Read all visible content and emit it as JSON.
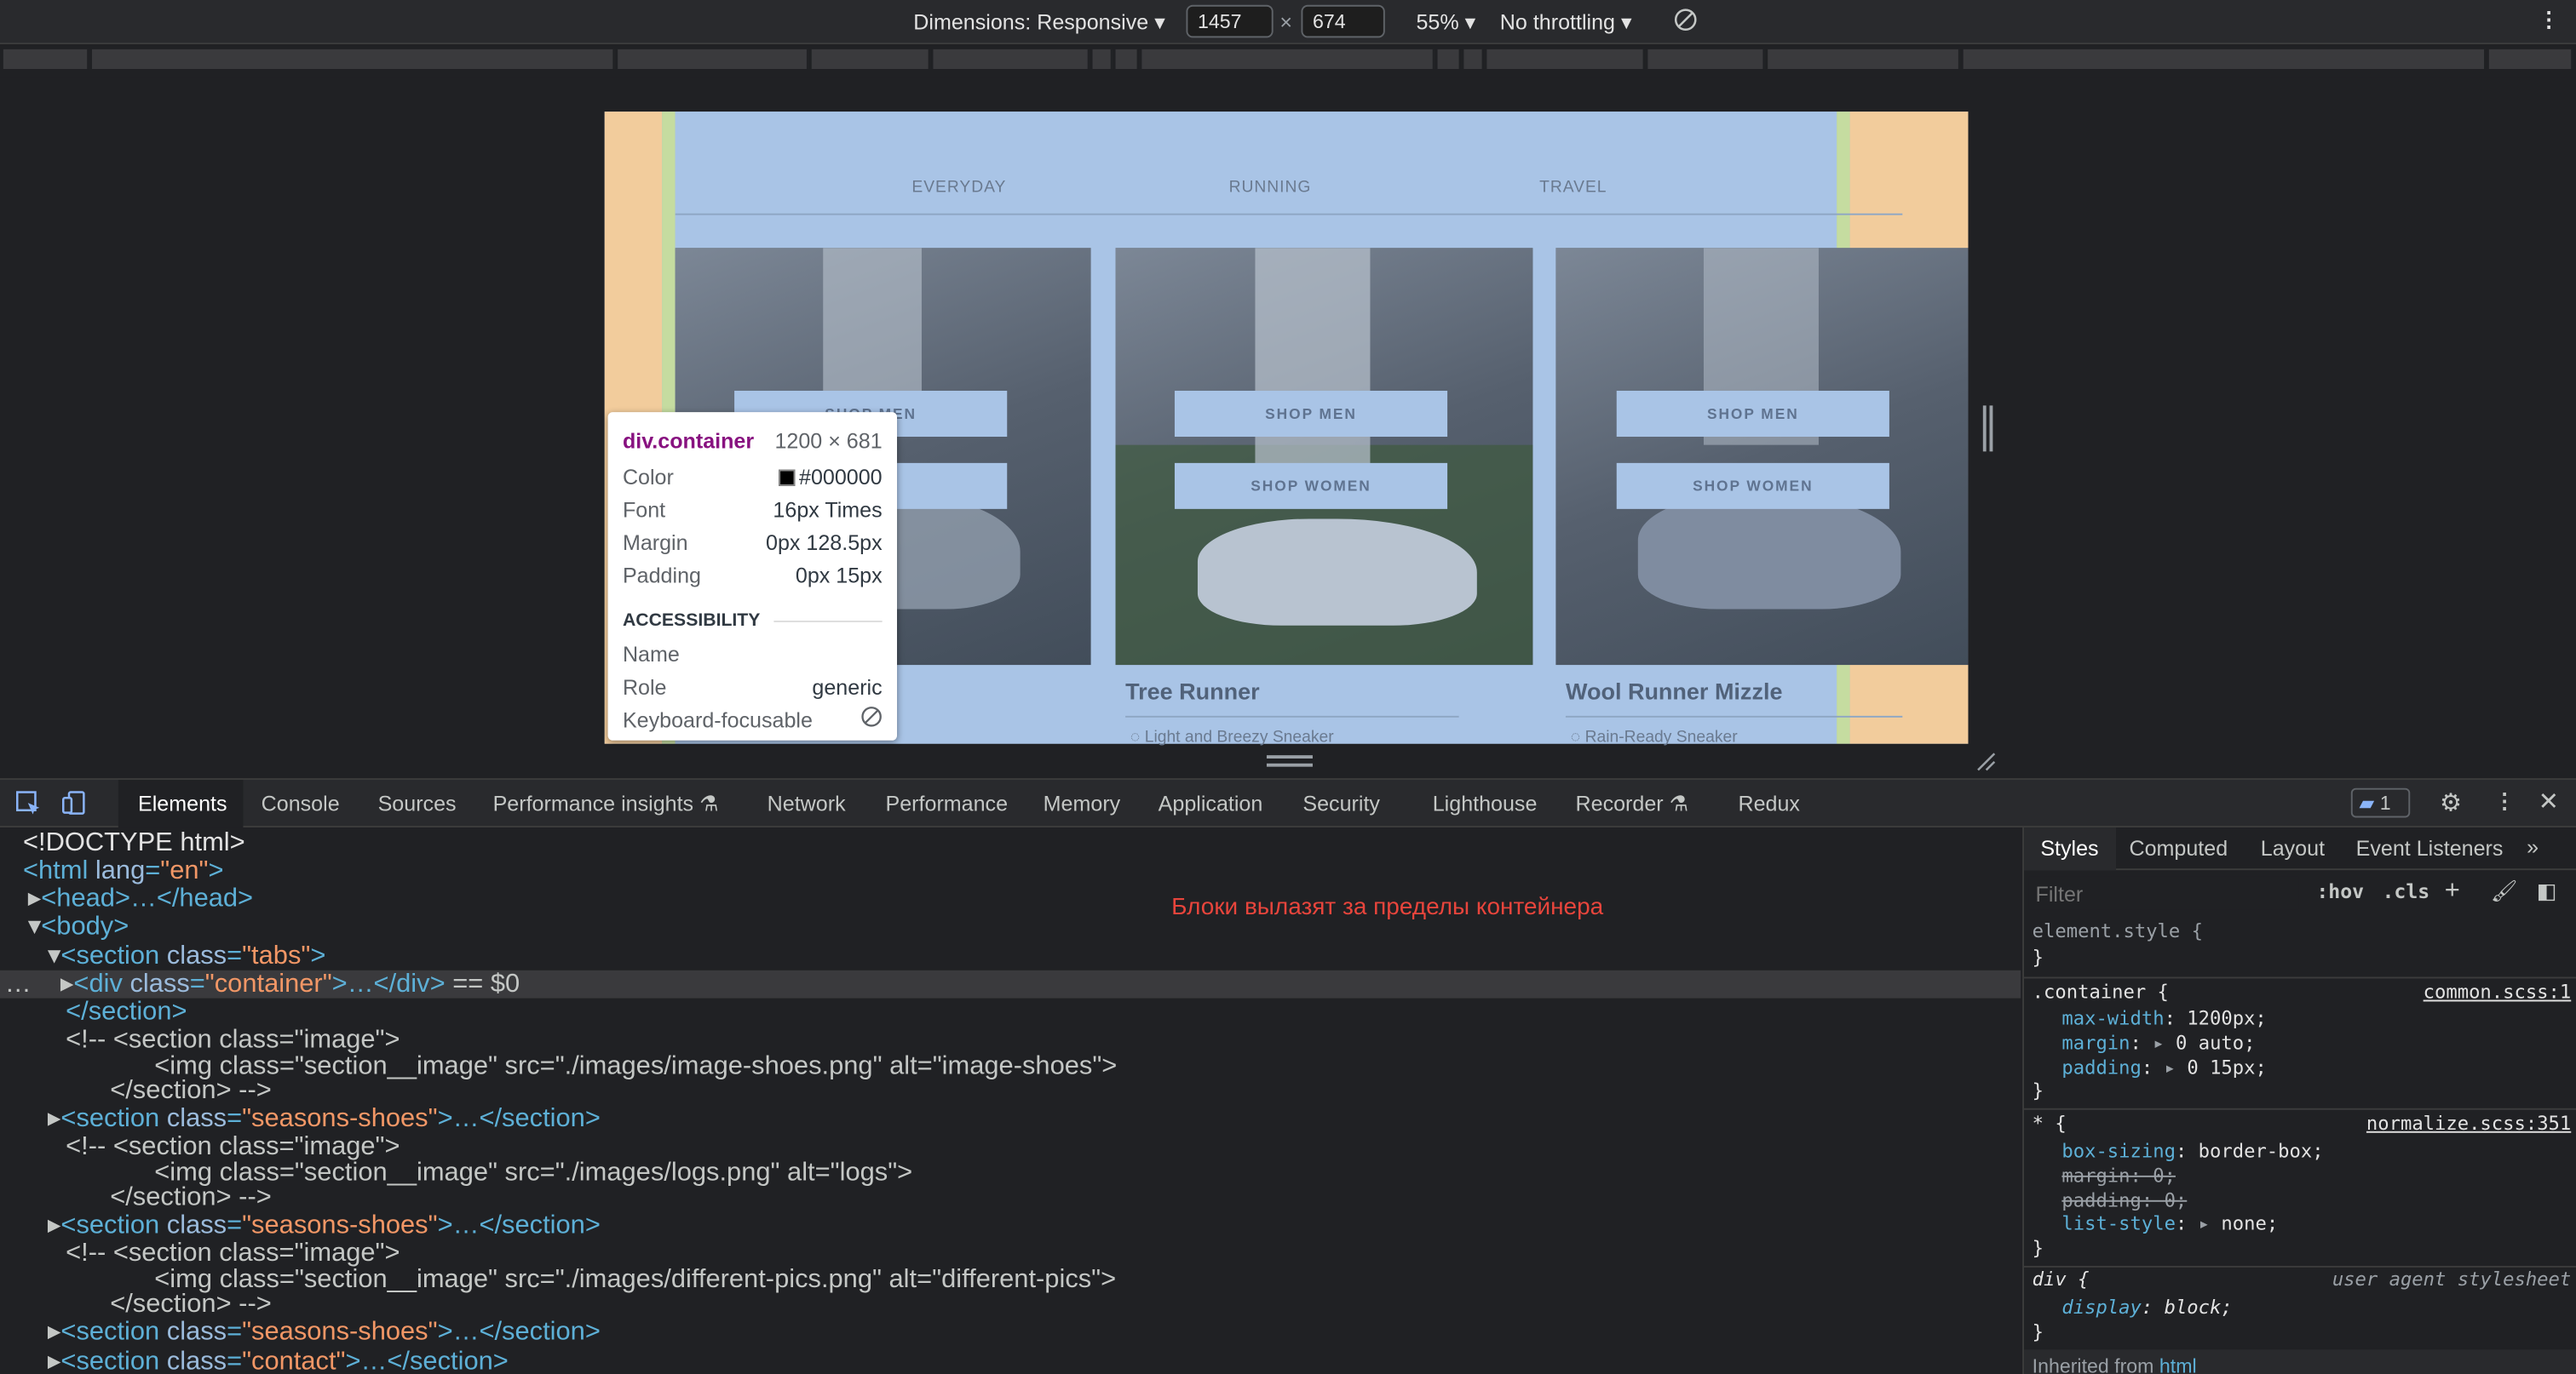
{
  "toolbar": {
    "dimensions_label": "Dimensions: Responsive",
    "width_value": "1457",
    "height_value": "674",
    "times": "×",
    "zoom": "55%",
    "throttling": "No throttling"
  },
  "page": {
    "tabs": [
      "EVERYDAY",
      "RUNNING",
      "TRAVEL"
    ],
    "cards": [
      {
        "title": "",
        "subtitle": "",
        "btn_men": "SHOP MEN",
        "btn_women": "SHOP WOMEN"
      },
      {
        "title": "Tree Runner",
        "subtitle": "Light and Breezy Sneaker",
        "btn_men": "SHOP MEN",
        "btn_women": "SHOP WOMEN"
      },
      {
        "title": "Wool Runner Mizzle",
        "subtitle": "Rain-Ready Sneaker",
        "btn_men": "SHOP MEN",
        "btn_women": "SHOP WOMEN"
      }
    ],
    "partial_btn_men": "SHOP MEN",
    "partial_btn_women": "MEN"
  },
  "tooltip": {
    "selector": "div.container",
    "size": "1200 × 681",
    "color_label": "Color",
    "color_value": "#000000",
    "font_label": "Font",
    "font_value": "16px Times",
    "margin_label": "Margin",
    "margin_value": "0px 128.5px",
    "padding_label": "Padding",
    "padding_value": "0px 15px",
    "accessibility": "ACCESSIBILITY",
    "name_label": "Name",
    "role_label": "Role",
    "role_value": "generic",
    "kbd_label": "Keyboard-focusable"
  },
  "devtools_tabs": [
    "Elements",
    "Console",
    "Sources",
    "Performance insights",
    "Network",
    "Performance",
    "Memory",
    "Application",
    "Security",
    "Lighthouse",
    "Recorder",
    "Redux"
  ],
  "issues_count": "1",
  "annotation": "Блоки вылазят за пределы контейнера",
  "elements": {
    "doctype": "<!DOCTYPE html>",
    "html_open": "<html ",
    "html_attr": "lang",
    "html_val": "\"en\"",
    "head": "<head>…</head>",
    "body": "<body>",
    "section_tabs": "<section ",
    "class_attr": "class",
    "tabs_val": "\"tabs\"",
    "div_container_val": "\"container\"",
    "ellipsis_div": ">…</div>",
    "selected_marker": "== $0",
    "section_close": "</section>",
    "comment_image_open": "<!-- <section class=\"image\">",
    "img1": "<img class=\"section__image\" src=\"./images/image-shoes.png\" alt=\"image-shoes\">",
    "comment_close": "</section> -->",
    "seasons_val": "\"seasons-shoes\"",
    "seasons_tail": ">…</section>",
    "img2": "<img class=\"section__image\" src=\"./images/logs.png\" alt=\"logs\">",
    "img3": "<img class=\"section__image\" src=\"./images/different-pics.png\" alt=\"different-pics\">",
    "contact_val": "\"contact\""
  },
  "styles": {
    "tabs": [
      "Styles",
      "Computed",
      "Layout",
      "Event Listeners"
    ],
    "filter_placeholder": "Filter",
    "hov": ":hov",
    "cls": ".cls",
    "element_style": "element.style {",
    "close_brace": "}",
    "container_selector": ".container {",
    "container_source": "common.scss:1",
    "max_width": "max-width",
    "max_width_val": "1200px;",
    "margin": "margin",
    "margin_val": "0 auto;",
    "padding": "padding",
    "padding_val": "0 15px;",
    "star_selector": "* {",
    "star_source": "normalize.scss:351",
    "box_sizing": "box-sizing",
    "box_sizing_val": "border-box;",
    "margin_struck": "margin: 0;",
    "padding_struck": "padding: 0;",
    "list_style": "list-style",
    "list_style_val": "none;",
    "div_selector": "div {",
    "ua_source": "user agent stylesheet",
    "display": "display",
    "display_val": "block;",
    "inherited": "Inherited from",
    "inherited_tag": "html"
  }
}
